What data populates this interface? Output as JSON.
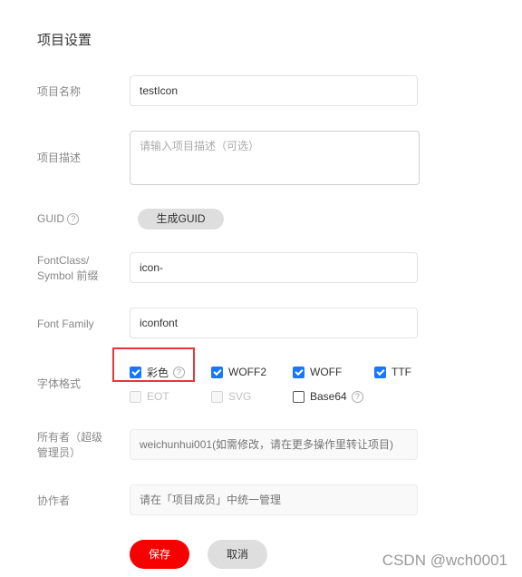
{
  "page": {
    "title": "项目设置"
  },
  "form": {
    "name": {
      "label": "项目名称",
      "value": "testIcon"
    },
    "description": {
      "label": "项目描述",
      "placeholder": "请输入项目描述（可选）",
      "value": ""
    },
    "guid": {
      "label": "GUID",
      "help_icon": "question-circle-icon",
      "button_label": "生成GUID"
    },
    "prefix": {
      "label_line1": "FontClass/",
      "label_line2": "Symbol 前缀",
      "value": "icon-"
    },
    "font_family": {
      "label": "Font Family",
      "value": "iconfont"
    },
    "font_format": {
      "label": "字体格式",
      "options": [
        {
          "label": "彩色",
          "checked": true,
          "disabled": false,
          "help": true
        },
        {
          "label": "WOFF2",
          "checked": true,
          "disabled": false
        },
        {
          "label": "WOFF",
          "checked": true,
          "disabled": false
        },
        {
          "label": "TTF",
          "checked": true,
          "disabled": false
        },
        {
          "label": "EOT",
          "checked": false,
          "disabled": true
        },
        {
          "label": "SVG",
          "checked": false,
          "disabled": true
        },
        {
          "label": "Base64",
          "checked": false,
          "disabled": false,
          "help": true
        }
      ]
    },
    "owner": {
      "label_line1": "所有者（超级",
      "label_line2": "管理员）",
      "placeholder": "weichunhui001(如需修改，请在更多操作里转让项目)"
    },
    "collaborator": {
      "label": "协作者",
      "placeholder": "请在「项目成员」中统一管理"
    }
  },
  "actions": {
    "save_label": "保存",
    "cancel_label": "取消"
  },
  "colors": {
    "primary": "#f70000",
    "checkbox": "#1677ff",
    "highlight_box": "#e8363a"
  },
  "watermark": "CSDN @wch0001"
}
